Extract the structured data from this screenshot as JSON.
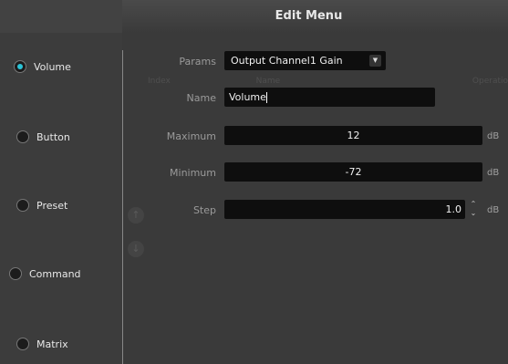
{
  "window": {
    "title": "Edit Menu"
  },
  "sidebar": {
    "items": [
      {
        "label": "Volume",
        "selected": true
      },
      {
        "label": "Button",
        "selected": false
      },
      {
        "label": "Preset",
        "selected": false
      },
      {
        "label": "Command",
        "selected": false
      },
      {
        "label": "Matrix",
        "selected": false
      }
    ]
  },
  "background_table": {
    "headers": [
      "Index",
      "Name",
      "Operatio"
    ]
  },
  "form": {
    "params_label": "Params",
    "params_value": "Output Channel1 Gain",
    "name_label": "Name",
    "name_value": "Volume",
    "max_label": "Maximum",
    "max_value": "12",
    "max_unit": "dB",
    "min_label": "Minimum",
    "min_value": "-72",
    "min_unit": "dB",
    "step_label": "Step",
    "step_value": "1.0",
    "step_unit": "dB"
  },
  "colors": {
    "accent": "#2bc3d6",
    "field_bg": "#0e0e0e",
    "window_bg": "#3a3a3a"
  }
}
